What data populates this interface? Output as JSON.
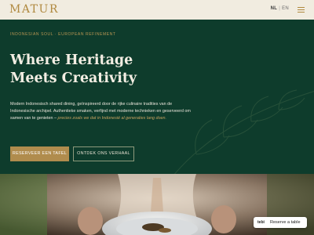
{
  "header": {
    "logo": "MATUR",
    "lang_nl": "NL",
    "lang_separator": "|",
    "lang_en": "EN",
    "menu_icon": "hamburger-menu-icon"
  },
  "hero": {
    "eyebrow": "INDONESIAN SOUL · EUROPEAN REFINEMENT",
    "title_line1": "Where Heritage",
    "title_line2": "Meets Creativity",
    "description": "Modern Indonesisch shared dining, geïnspireerd door de rijke culinaire tradities van de Indonesische archipel. Authentieke smaken, verfijnd met moderne technieken en geserveerd om samen van te genieten – ",
    "description_accent": "precies zoals we dat in Indonesië al generaties lang doen.",
    "primary_button": "RESERVEER EEN TAFEL",
    "secondary_button": "ONTDEK ONS VERHAAL",
    "decor_icon": "leaf-icon"
  },
  "widget": {
    "brand": "tebi",
    "label": "Reserve a table"
  },
  "colors": {
    "hero_bg": "#0e3c2c",
    "gold": "#b08c4d",
    "header_bg": "#f1ece0"
  }
}
